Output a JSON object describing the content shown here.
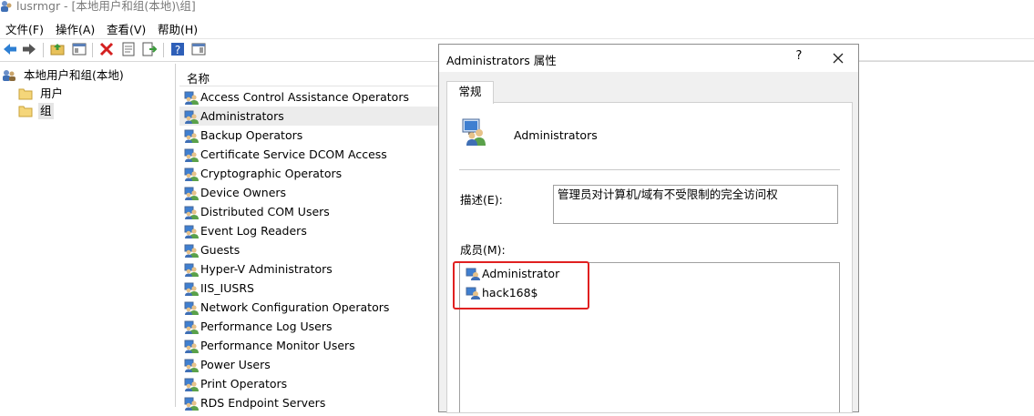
{
  "window": {
    "title": "lusrmgr - [本地用户和组(本地)\\组]"
  },
  "menu": {
    "file": "文件(F)",
    "action": "操作(A)",
    "view": "查看(V)",
    "help": "帮助(H)"
  },
  "tree": {
    "root": "本地用户和组(本地)",
    "users": "用户",
    "groups": "组"
  },
  "list": {
    "header": "名称",
    "rows": [
      "Access Control Assistance Operators",
      "Administrators",
      "Backup Operators",
      "Certificate Service DCOM Access",
      "Cryptographic Operators",
      "Device Owners",
      "Distributed COM Users",
      "Event Log Readers",
      "Guests",
      "Hyper-V Administrators",
      "IIS_IUSRS",
      "Network Configuration Operators",
      "Performance Log Users",
      "Performance Monitor Users",
      "Power Users",
      "Print Operators",
      "RDS Endpoint Servers"
    ]
  },
  "dialog": {
    "title": "Administrators 属性",
    "help_button": "?",
    "tab_general": "常规",
    "group_name": "Administrators",
    "description_label": "描述(E):",
    "description_value": "管理员对计算机/域有不受限制的完全访问权",
    "members_label": "成员(M):",
    "members": [
      "Administrator",
      "hack168$"
    ]
  },
  "colors": {
    "highlight": "#e02020",
    "selected_row": "#ececec"
  }
}
